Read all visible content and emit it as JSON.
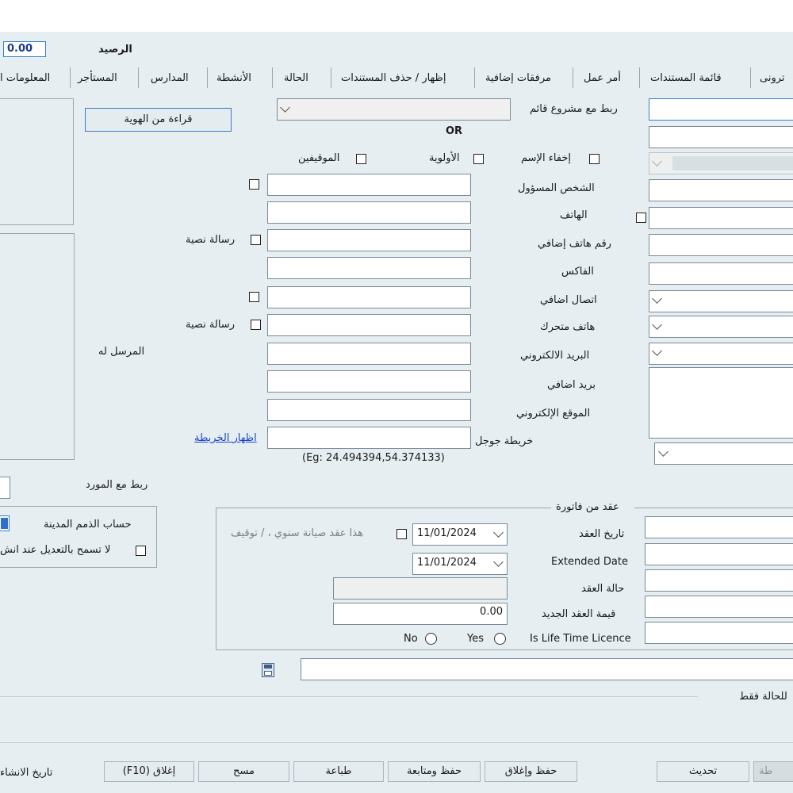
{
  "header": {
    "balance_label": "الرصيد",
    "balance_value": "0.00"
  },
  "tabs": [
    "المعلومات ا",
    "المستأجر",
    "المدارس",
    "الأنشطة",
    "الحالة",
    "إظهار / حذف المستندات",
    "مرفقات إضافية",
    "أمر عمل",
    "قائمة المستندات",
    "ترونى"
  ],
  "form": {
    "link_project_label": "ربط مع مشروع قائم",
    "or_text": "OR",
    "read_id_button": "قراءة من الهوية",
    "hide_name_label": "إخفاء الإسم",
    "priority_label": "الأولوية",
    "suspended_label": "الموقيفين",
    "responsible_label": "الشخص المسؤول",
    "phone_label": "الهاتف",
    "extra_phone_label": "رقم هاتف إضافي",
    "fax_label": "الفاكس",
    "extra_contact_label": "اتصال اضافي",
    "mobile_label": "هاتف متحرك",
    "email_label": "البريد الالكتروني",
    "extra_email_label": "بريد اضافي",
    "website_label": "الموقع الإلكتروني",
    "google_map_label": "خريطة جوجل",
    "show_map_link": "اظهار الخريطة",
    "map_example": "(Eg: 24.494394,54.374133)",
    "sms_label_1": "رسالة نصية",
    "sms_label_2": "رسالة نصية",
    "sent_to_label": "المرسل له",
    "link_supplier_label": "ربط مع المورد",
    "receivables_account_label": "حساب الذمم المدينة",
    "no_edit_label": "لا تسمح بالتعديل عند انش"
  },
  "contract": {
    "section_title": "عقد من فاتورة",
    "contract_date_label": "تاريخ العقد",
    "contract_date_value": "11/01/2024",
    "annual_maintenance_label": "هذا عقد صيانة سنوي ، / توقيف",
    "extended_date_label": "Extended Date",
    "extended_date_value": "11/01/2024",
    "contract_status_label": "حالة العقد",
    "new_value_label": "قيمة العقد الجديد",
    "new_value": "0.00",
    "lifetime_label": "Is Life Time Licence",
    "yes_label": "Yes",
    "no_label": "No"
  },
  "footer": {
    "state_only_label": "للحالة فقط",
    "creation_date_label": "تاريخ الانشاء",
    "buttons": {
      "close": "إغلاق (F10)",
      "clear": "مسح",
      "print": "طباعة",
      "save_continue": "حفظ ومتابعة",
      "save_close": "حفظ وإغلاق",
      "refresh": "تحديث",
      "partial": "طة"
    }
  }
}
